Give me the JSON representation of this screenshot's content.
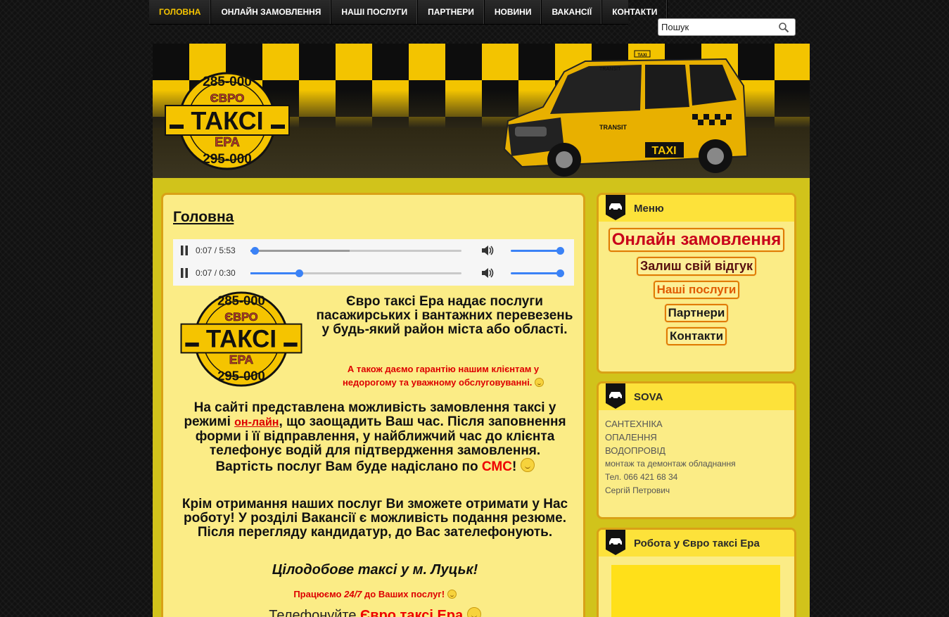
{
  "nav": {
    "items": [
      {
        "label": "ГОЛОВНА",
        "active": true
      },
      {
        "label": "ОНЛАЙН ЗАМОВЛЕННЯ"
      },
      {
        "label": "НАШІ ПОСЛУГИ"
      },
      {
        "label": "ПАРТНЕРИ"
      },
      {
        "label": "НОВИНИ"
      },
      {
        "label": "ВАКАНСІЇ"
      },
      {
        "label": "КОНТАКТИ"
      }
    ]
  },
  "search": {
    "placeholder": "Пошук",
    "value": "Пошук"
  },
  "logo": {
    "top_number": "285-000",
    "brand": "ЄВРО",
    "word": "ТАКСІ",
    "sub": "ЕРА",
    "bottom_number": "295-000"
  },
  "van": {
    "roof_label": "TRANSIT",
    "side_label": "TRANSIT",
    "taxi_label": "TAXI",
    "sign": "TAXI"
  },
  "main": {
    "title": "Головна",
    "players": [
      {
        "time": "0:07 / 5:53",
        "progress": 0.02,
        "buffered": 0.47
      },
      {
        "time": "0:07 / 0:30",
        "progress": 0.23,
        "buffered": 0.23
      }
    ],
    "intro": "Євро таксі Ера надає послуги пасажирських і вантажних перевезень у будь-який район міста або області.",
    "guarantee": "А також даємо гарантію нашим клієнтам у недорогому та уважному обслуговуванні.",
    "para1_a": "На сайті представлена можливість замовлення таксі у режимі ",
    "para1_link": "он-лайн",
    "para1_b": ", що заощадить Ваш час. Після заповнення форми і її відправлення, у найближчий час до клієнта телефонує водій для підтвердження замовлення.",
    "price_a": "Вартість послуг Вам буде надіслано по ",
    "price_sms": "СМС",
    "price_b": "!",
    "para2": "Крім отримання наших послуг Ви зможете отримати у Нас роботу! У розділі Вакансії є можливість подання резюме. Після перегляду кандидатур, до Вас зателефонують.",
    "slogan": "Цілодобове таксі у м. Луцьк!",
    "work_a": "Працюємо ",
    "work_247": "24/7",
    "work_b": " до Ваших послуг!",
    "call_a": "Телефонуйте ",
    "call_brand": "Євро таксі Ера"
  },
  "sidebar": {
    "menu_title": "Меню",
    "menu": [
      {
        "label": "Онлайн замовлення",
        "color": "#c8001a",
        "size": 24
      },
      {
        "label": "Залиш свій відгук",
        "color": "#5a1010",
        "size": 18
      },
      {
        "label": "Наші послуги",
        "color": "#e05a00",
        "size": 17
      },
      {
        "label": "Партнери",
        "color": "#1a1a1a",
        "size": 17
      },
      {
        "label": "Контакти",
        "color": "#1a1a1a",
        "size": 17
      }
    ],
    "sova_title": "SOVA",
    "sova": [
      "САНТЕХНІКА",
      "ОПАЛЕННЯ",
      "ВОДОПРОВІД",
      "монтаж та демонтаж обладнання",
      "Тел. 066 421 68 34",
      "Сергій Петрович"
    ],
    "job_title": "Робота у Євро таксі Ера"
  },
  "colors": {
    "accent": "#f5c400",
    "box_bg": "#fbec86",
    "border": "#d9a116",
    "alert": "#dd0000"
  }
}
